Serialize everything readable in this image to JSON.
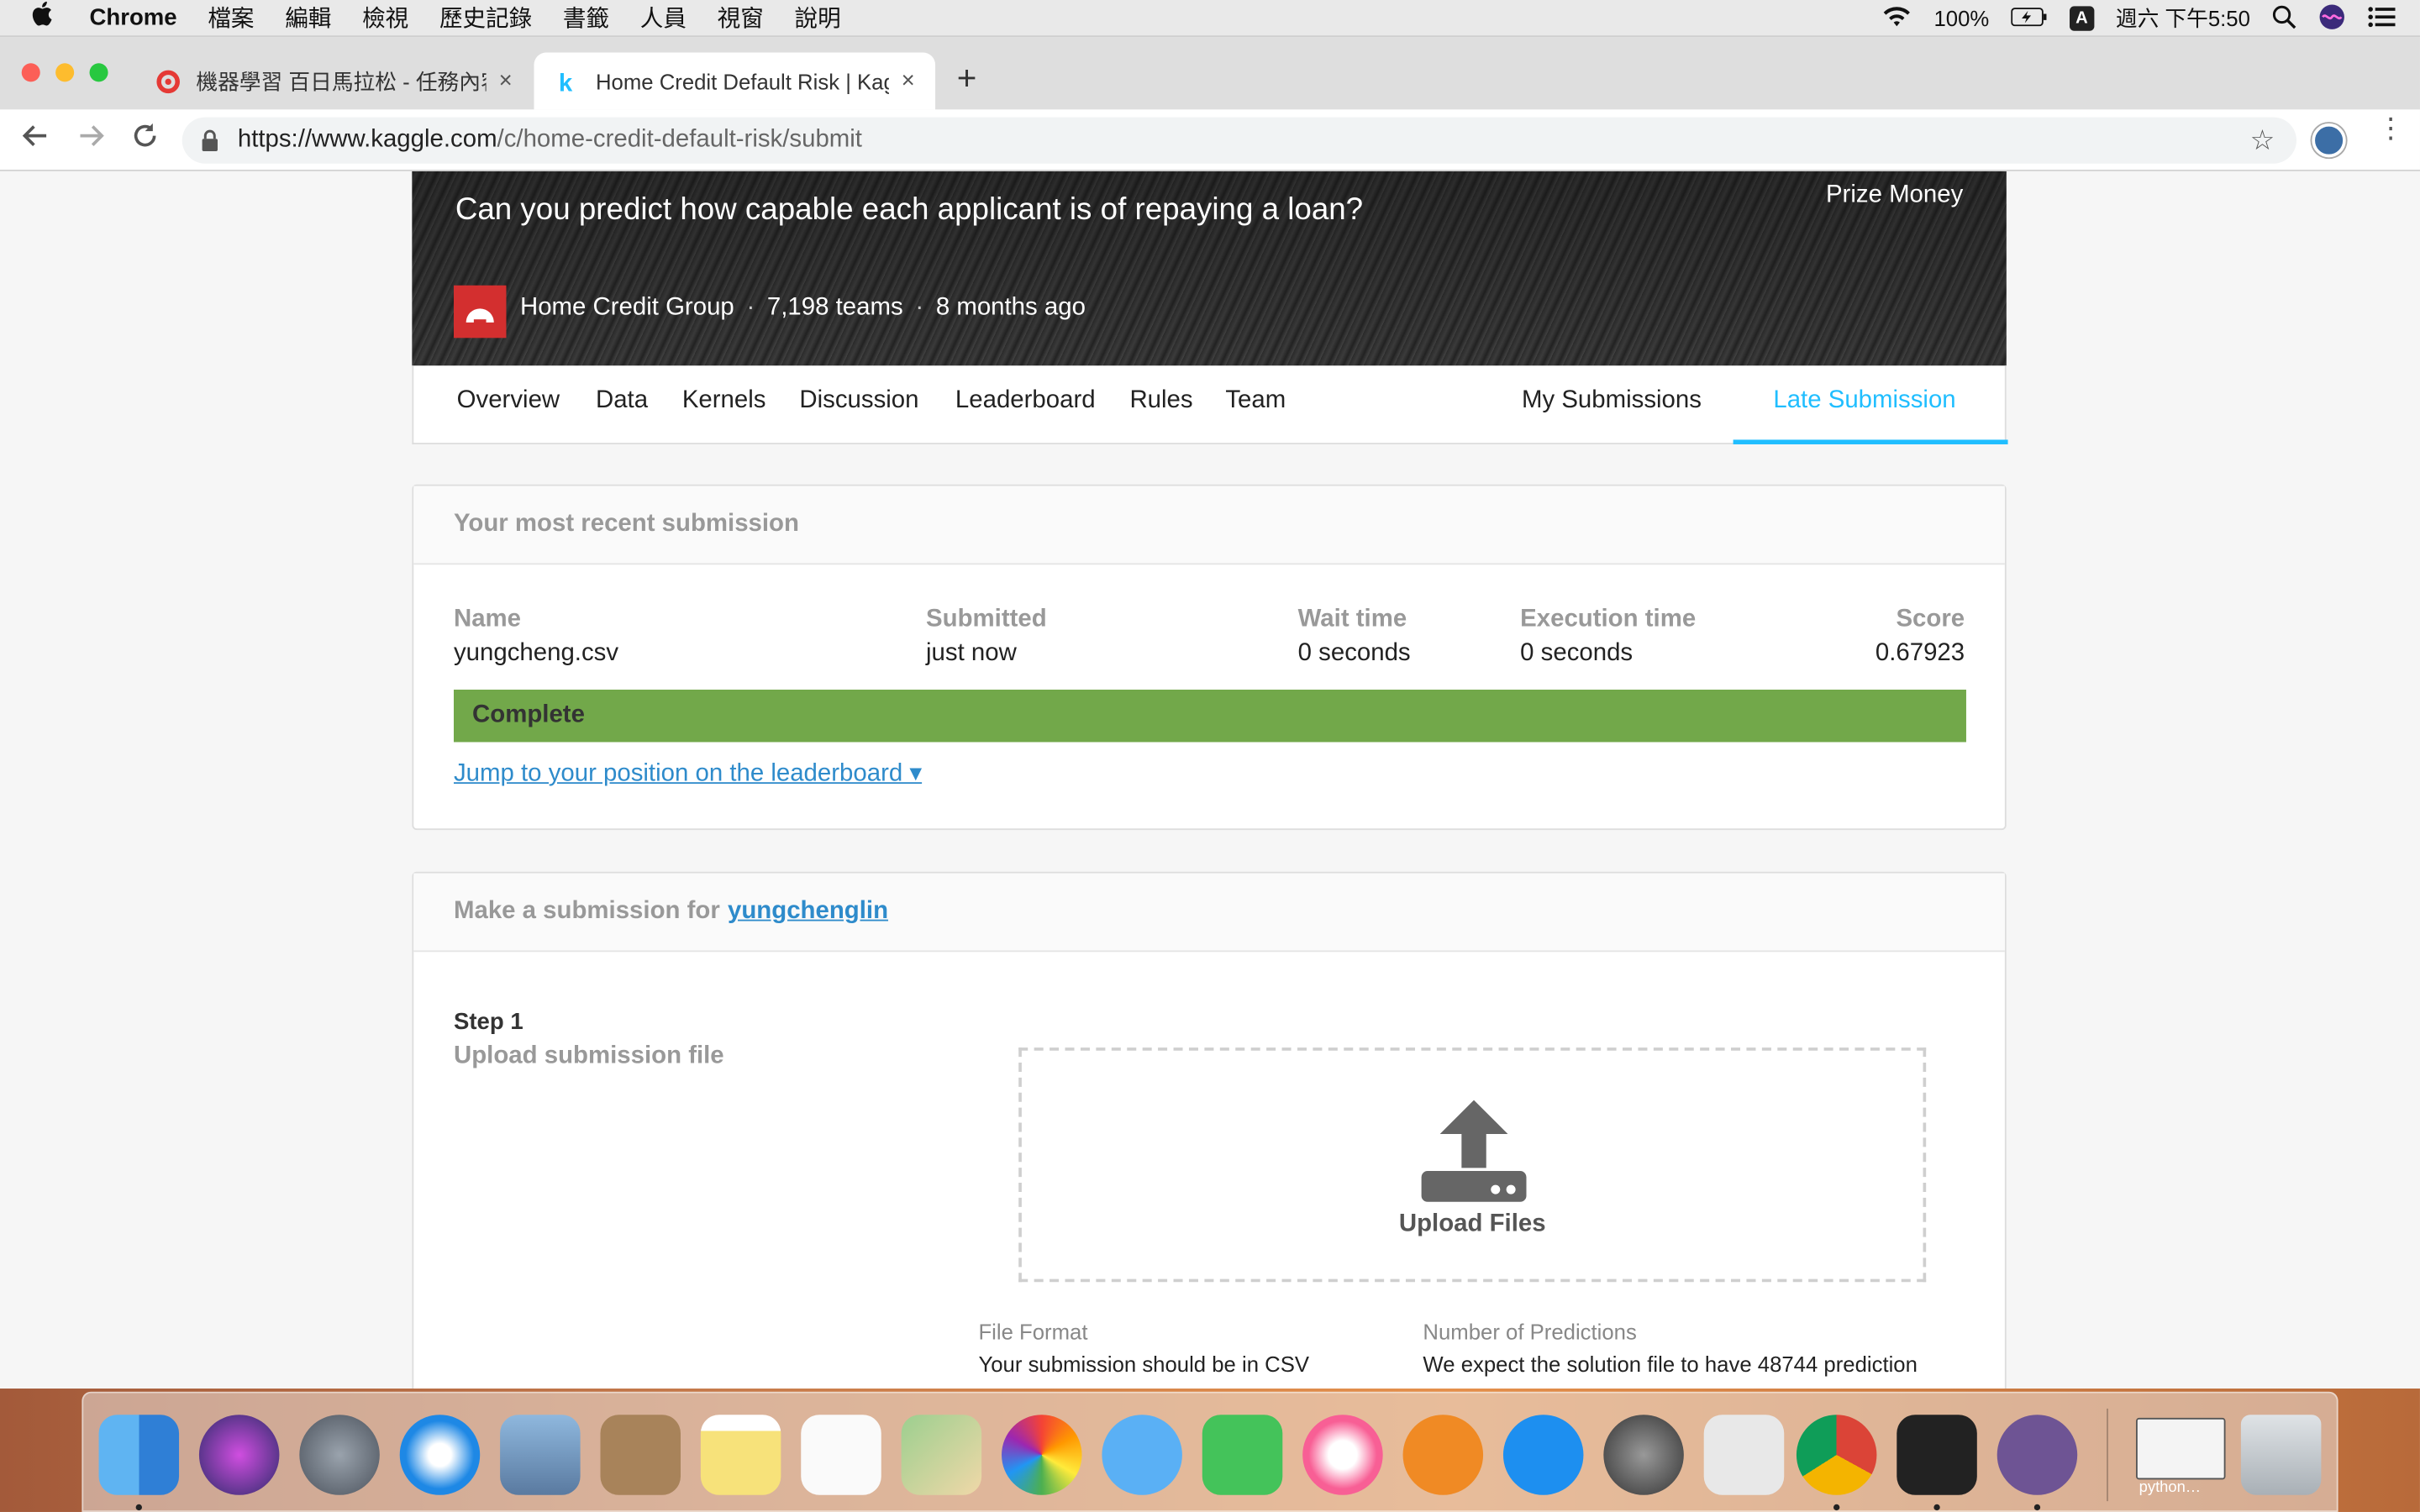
{
  "menubar": {
    "app_name": "Chrome",
    "items": [
      "檔案",
      "編輯",
      "檢視",
      "歷史記錄",
      "書籤",
      "人員",
      "視窗",
      "說明"
    ],
    "battery": "100%",
    "input_method": "A",
    "clock": "週六 下午5:50"
  },
  "tabs": [
    {
      "title": "機器學習 百日馬拉松 - 任務內容",
      "close": "×"
    },
    {
      "title": "Home Credit Default Risk | Kag",
      "close": "×"
    }
  ],
  "new_tab": "+",
  "address": {
    "url_host": "https://www.kaggle.com",
    "url_path": "/c/home-credit-default-risk/submit"
  },
  "hero": {
    "headline": "Can you predict how capable each applicant is of repaying a loan?",
    "prize": "Prize Money",
    "org": "Home Credit Group",
    "teams": "7,198 teams",
    "age": "8 months ago",
    "sep": "·"
  },
  "compnav": {
    "items": [
      "Overview",
      "Data",
      "Kernels",
      "Discussion",
      "Leaderboard",
      "Rules",
      "Team"
    ],
    "my_submissions": "My Submissions",
    "late_submission": "Late Submission"
  },
  "recent": {
    "title": "Your most recent submission",
    "headers": {
      "name": "Name",
      "submitted": "Submitted",
      "wait": "Wait time",
      "exec": "Execution time",
      "score": "Score"
    },
    "values": {
      "name": "yungcheng.csv",
      "submitted": "just now",
      "wait": "0 seconds",
      "exec": "0 seconds",
      "score": "0.67923"
    },
    "status": "Complete",
    "jump_link": "Jump to your position on the leaderboard ▾"
  },
  "make_submission": {
    "title_prefix": "Make a submission for",
    "user": "yungchenglin",
    "step_label": "Step 1",
    "step_sub": "Upload submission file",
    "upload_label": "Upload Files",
    "file_format_h": "File Format",
    "file_format_v": "Your submission should be in CSV",
    "predictions_h": "Number of Predictions",
    "predictions_v": "We expect the solution file to have 48744 prediction"
  },
  "dock": {
    "caption": "python…"
  },
  "colors": {
    "kaggle_blue": "#20beff",
    "status_green": "#72a84a",
    "link_blue": "#2e8bcb"
  }
}
